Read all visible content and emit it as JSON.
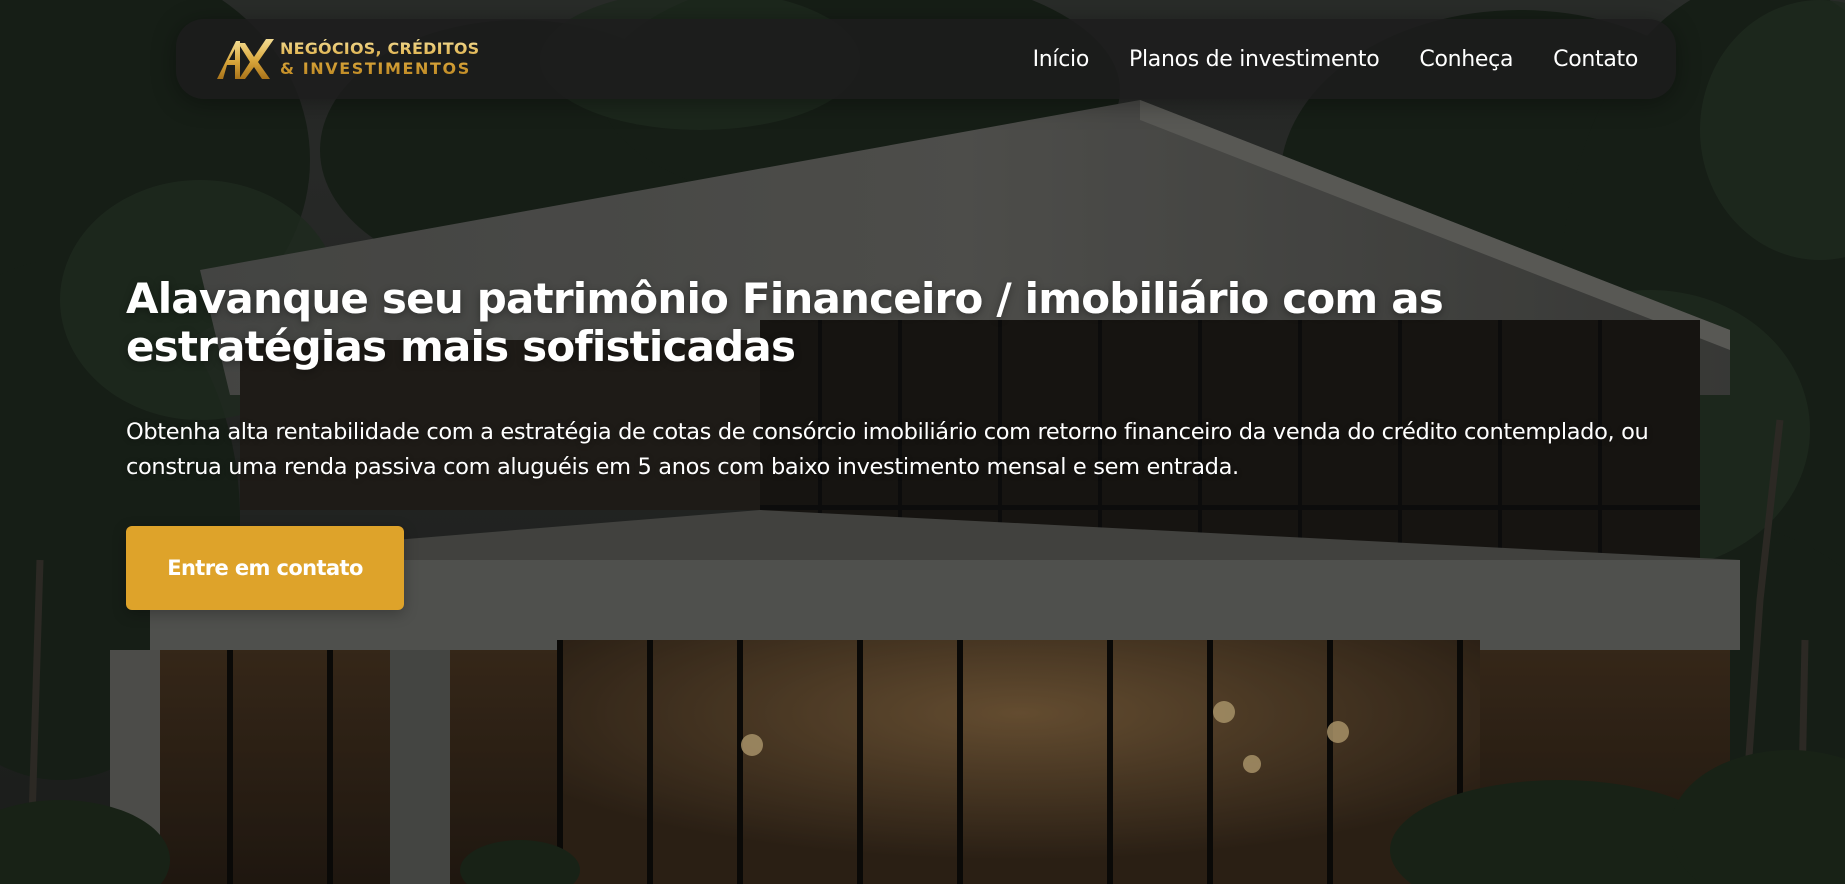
{
  "brand": {
    "name_line1": "NEGÓCIOS, CRÉDITOS",
    "name_line2": "& INVESTIMENTOS",
    "logo_icon": "ax-monogram-icon",
    "gold": "#d8a53a"
  },
  "nav": {
    "items": [
      {
        "label": "Início"
      },
      {
        "label": "Planos de investimento"
      },
      {
        "label": "Conheça"
      },
      {
        "label": "Contato"
      }
    ]
  },
  "hero": {
    "title": "Alavanque seu patrimônio Financeiro / imobiliário com as estratégias mais sofisticadas",
    "description": "Obtenha alta rentabilidade com a estratégia de cotas de consórcio imobiliário com retorno financeiro da venda do crédito contemplado, ou construa uma renda passiva com aluguéis em 5 anos com baixo investimento mensal e sem entrada.",
    "cta_label": "Entre em contato",
    "background": "modern-house-photo"
  },
  "colors": {
    "accent": "#dea32a",
    "navbar_bg": "#1c1c1c",
    "text": "#ffffff"
  }
}
